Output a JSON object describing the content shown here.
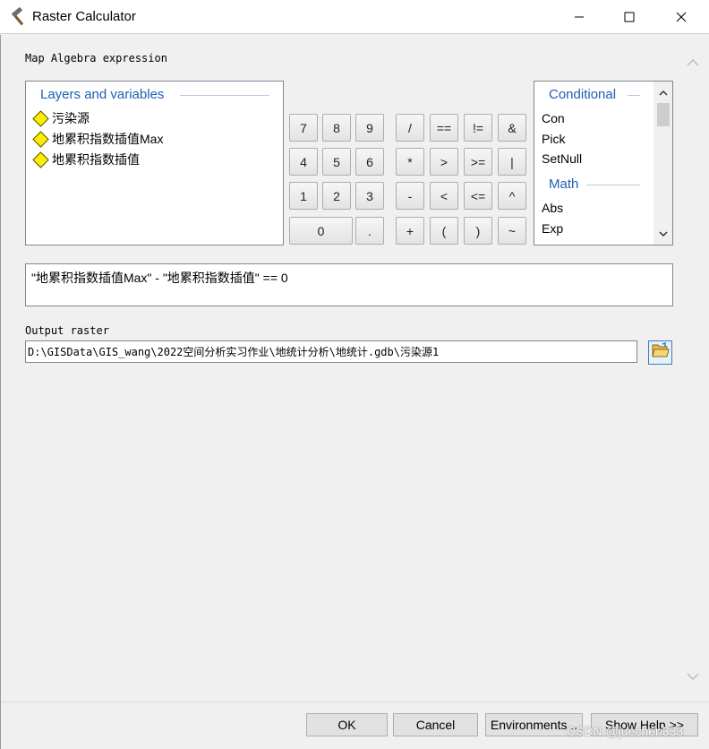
{
  "window": {
    "title": "Raster Calculator"
  },
  "labels": {
    "expression": "Map Algebra expression",
    "output": "Output raster"
  },
  "layers": {
    "header": "Layers and variables",
    "items": [
      "污染源",
      "地累积指数插值Max",
      "地累积指数插值"
    ]
  },
  "calculator": {
    "rows": [
      [
        "7",
        "8",
        "9",
        "/",
        "==",
        "!=",
        "&"
      ],
      [
        "4",
        "5",
        "6",
        "*",
        ">",
        ">=",
        "|"
      ],
      [
        "1",
        "2",
        "3",
        "-",
        "<",
        "<=",
        "^"
      ],
      [
        "0",
        ".",
        "+",
        "(",
        ")",
        "~"
      ]
    ]
  },
  "functions": {
    "groups": [
      {
        "header": "Conditional",
        "items": [
          "Con",
          "Pick",
          "SetNull"
        ]
      },
      {
        "header": "Math",
        "items": [
          "Abs",
          "Exp"
        ]
      }
    ]
  },
  "expression": "\"地累积指数插值Max\" - \"地累积指数插值\" == 0",
  "output_path": "D:\\GISData\\GIS_wang\\2022空间分析实习作业\\地统计分析\\地统计.gdb\\污染源1",
  "buttons": {
    "ok": "OK",
    "cancel": "Cancel",
    "environments": "Environments...",
    "show_help": "Show Help >>"
  },
  "watermark": "CSDN @juechen333",
  "icons": {
    "app": "hammer-icon",
    "folder": "open-folder-icon"
  }
}
